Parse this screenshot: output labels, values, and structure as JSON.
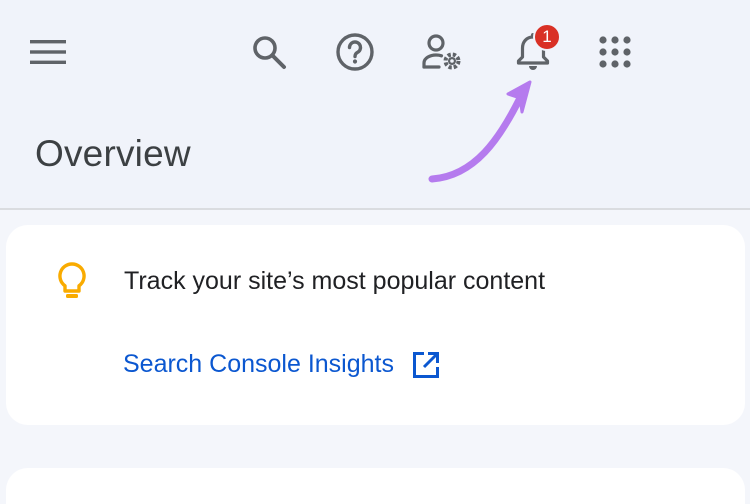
{
  "header": {
    "notification_count": "1",
    "icons": [
      "menu-icon",
      "search-icon",
      "help-icon",
      "user-settings-icon",
      "bell-icon",
      "apps-grid-icon"
    ]
  },
  "page": {
    "title": "Overview"
  },
  "insights_card": {
    "text": "Track your site’s most popular content",
    "link_label": "Search Console Insights",
    "icons": [
      "lightbulb-icon",
      "open-in-new-icon"
    ]
  },
  "colors": {
    "background": "#f0f3fa",
    "link": "#0b57d0",
    "badge": "#d93025",
    "lightbulb": "#f9ab00",
    "annotation_arrow": "#b57bee",
    "icon": "#5f6368"
  }
}
